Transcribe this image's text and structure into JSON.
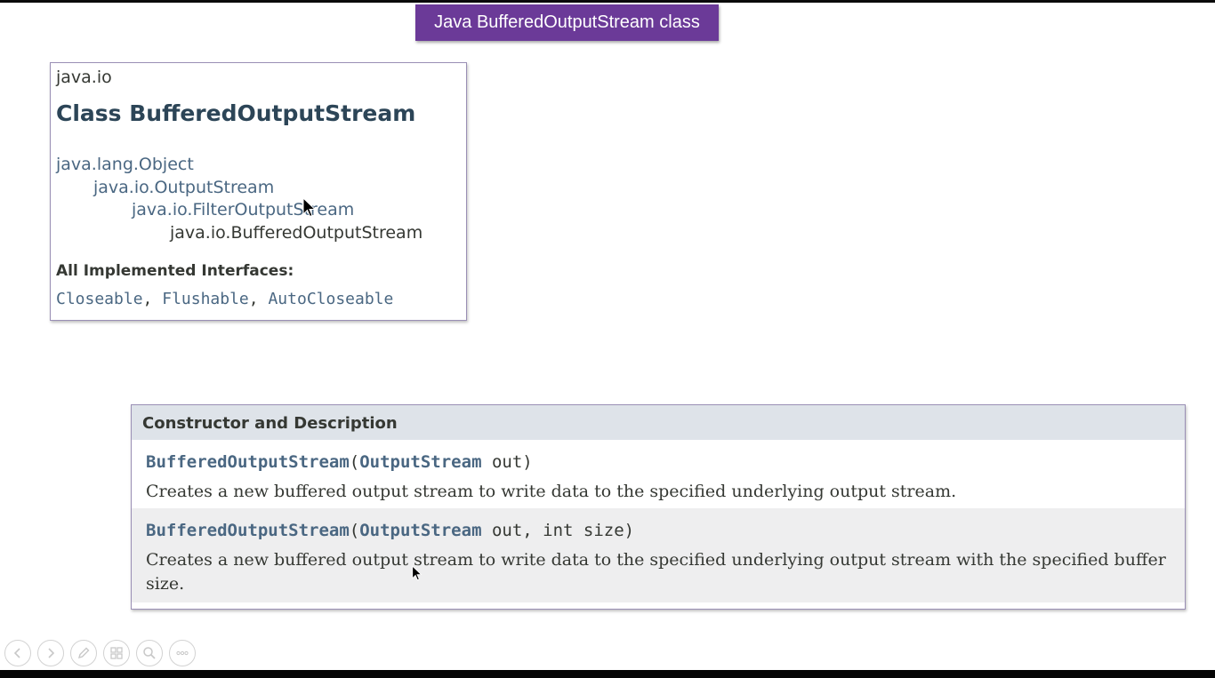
{
  "slide": {
    "title": "Java BufferedOutputStream class"
  },
  "class_card": {
    "package": "java.io",
    "class_title": "Class BufferedOutputStream",
    "inheritance": [
      "java.lang.Object",
      "java.io.OutputStream",
      "java.io.FilterOutputStream",
      "java.io.BufferedOutputStream"
    ],
    "interfaces_label": "All Implemented Interfaces:",
    "interfaces": [
      "Closeable",
      "Flushable",
      "AutoCloseable"
    ],
    "separator": ", "
  },
  "constructors": {
    "header": "Constructor and Description",
    "rows": [
      {
        "name": "BufferedOutputStream",
        "open": "(",
        "param_type": "OutputStream",
        "params_rest": " out)",
        "description": "Creates a new buffered output stream to write data to the specified underlying output stream."
      },
      {
        "name": "BufferedOutputStream",
        "open": "(",
        "param_type": "OutputStream",
        "params_rest": " out, int size)",
        "description": "Creates a new buffered output stream to write data to the specified underlying output stream with the specified buffer size."
      }
    ]
  },
  "slide_controls": [
    {
      "icon": "previous-icon"
    },
    {
      "icon": "next-icon"
    },
    {
      "icon": "pen-icon"
    },
    {
      "icon": "slides-icon"
    },
    {
      "icon": "zoom-icon"
    },
    {
      "icon": "more-icon"
    }
  ],
  "colors": {
    "banner": "#6b3a98",
    "link": "#4a6782",
    "text": "#353833",
    "table_header": "#dee3e9",
    "alt_row": "#eeeeef"
  }
}
